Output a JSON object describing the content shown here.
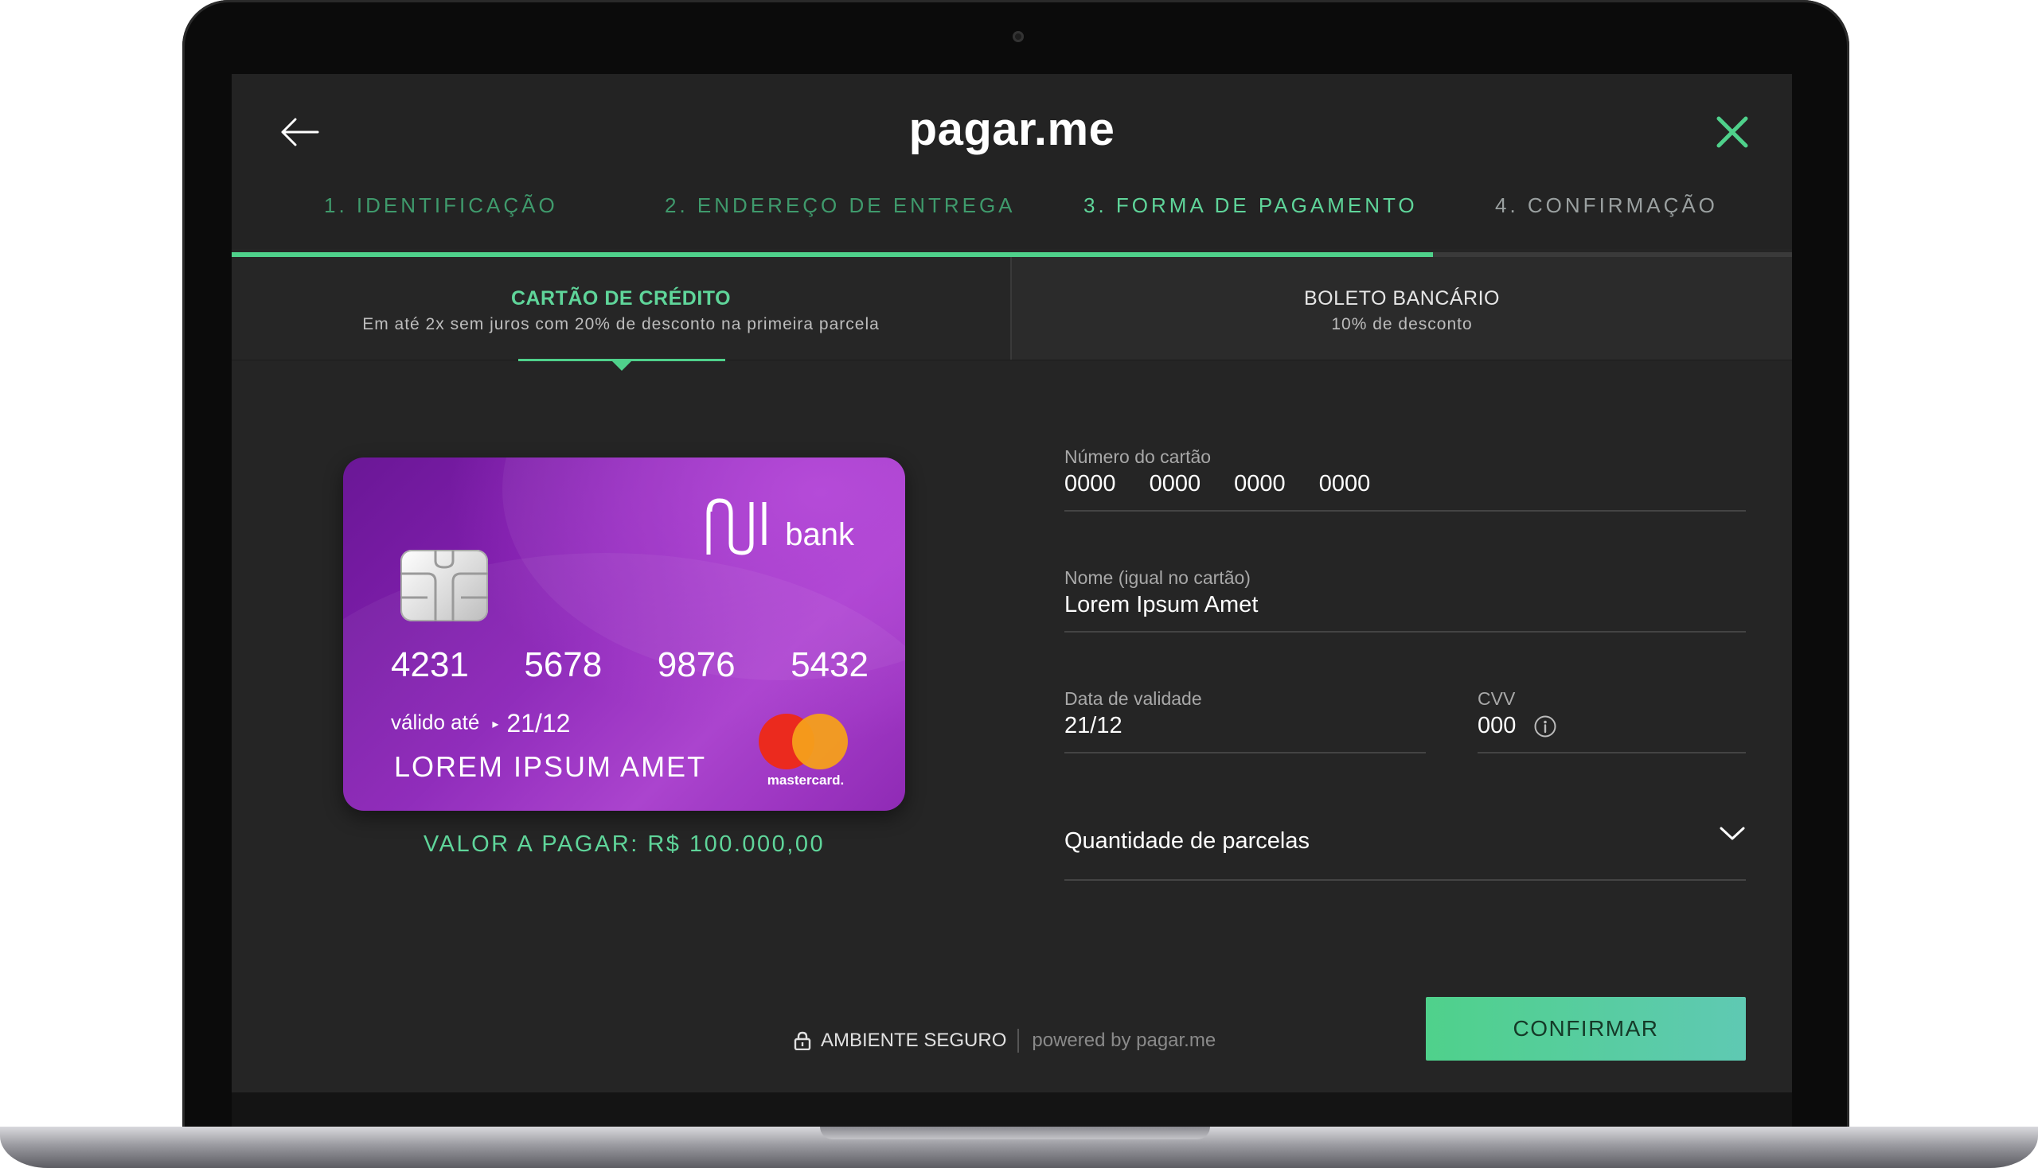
{
  "header": {
    "logo": "pagar.me"
  },
  "steps": [
    {
      "label": "1. IDENTIFICAÇÃO"
    },
    {
      "label": "2. ENDEREÇO DE ENTREGA"
    },
    {
      "label": "3. FORMA DE PAGAMENTO"
    },
    {
      "label": "4. CONFIRMAÇÃO"
    }
  ],
  "payment_tabs": {
    "credit": {
      "title": "CARTÃO DE CRÉDITO",
      "subtitle": "Em até 2x sem juros com 20% de desconto na primeira parcela"
    },
    "boleto": {
      "title": "BOLETO BANCÁRIO",
      "subtitle": "10% de desconto"
    }
  },
  "card": {
    "bank": "bank",
    "number": [
      "4231",
      "5678",
      "9876",
      "5432"
    ],
    "valid_label": "válido até",
    "valid_value": "21/12",
    "holder": "LOREM IPSUM AMET",
    "network": "mastercard.",
    "chip_icon": "chip-icon",
    "brand_icon": "nubank-logo-icon"
  },
  "amount": "VALOR A PAGAR: R$ 100.000,00",
  "form": {
    "card_number": {
      "label": "Número do cartão",
      "value": "0000 0000 0000 0000"
    },
    "name": {
      "label": "Nome (igual no cartão)",
      "value": "Lorem Ipsum Amet"
    },
    "expiry": {
      "label": "Data de validade",
      "value": "21/12"
    },
    "cvv": {
      "label": "CVV",
      "value": "000"
    },
    "installments": {
      "placeholder": "Quantidade de parcelas"
    }
  },
  "footer": {
    "secure": "AMBIENTE SEGURO",
    "powered": "powered by pagar.me",
    "confirm": "CONFIRMAR"
  },
  "colors": {
    "accent": "#4fd18b",
    "background": "#252525",
    "card_purple": "#8b22b8"
  },
  "progress": {
    "completed_fraction": 0.77
  }
}
